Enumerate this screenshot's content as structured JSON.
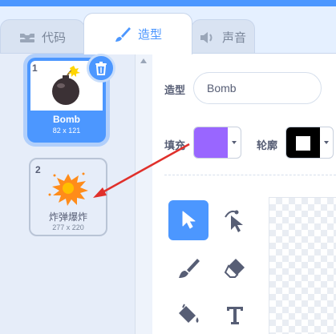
{
  "tabs": [
    {
      "label": "代码",
      "icon": "code-icon",
      "active": false
    },
    {
      "label": "造型",
      "icon": "brush-icon",
      "active": true
    },
    {
      "label": "声音",
      "icon": "speaker-icon",
      "active": false
    }
  ],
  "costumes": [
    {
      "number": "1",
      "name": "Bomb",
      "size": "82 x 121",
      "selected": true
    },
    {
      "number": "2",
      "name": "炸弹爆炸",
      "size": "277 x 220",
      "selected": false
    }
  ],
  "editor": {
    "costume_label": "造型",
    "costume_name": "Bomb",
    "fill_label": "填充",
    "fill_color": "#9966ff",
    "outline_label": "轮廓",
    "outline_color": "#000000"
  },
  "tools": [
    "select-icon",
    "reshape-icon",
    "brush-icon",
    "eraser-icon",
    "fill-icon",
    "text-icon"
  ],
  "colors": {
    "accent": "#4c97ff",
    "annotation_arrow": "#e0302b"
  }
}
